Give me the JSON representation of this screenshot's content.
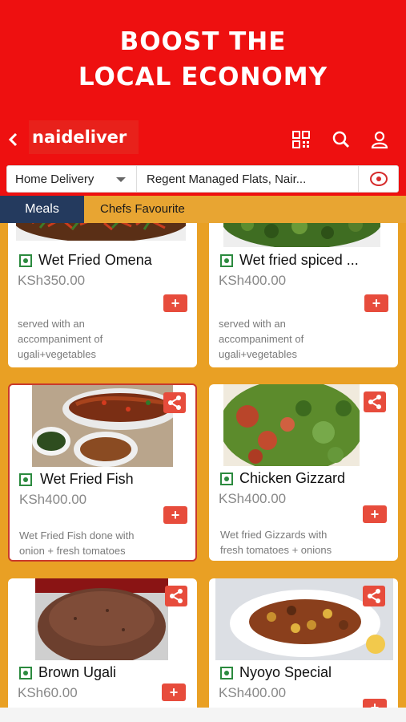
{
  "banner": {
    "line1": "BOOST THE",
    "line2": "LOCAL ECONOMY"
  },
  "header": {
    "back_icon": "chevron-left-icon",
    "logo_text": "naideliver",
    "icons": [
      "qr-code-icon",
      "search-icon",
      "user-icon"
    ]
  },
  "filters": {
    "delivery_mode": "Home Delivery",
    "address": "Regent Managed Flats, Nair...",
    "location_icon": "target-location-icon"
  },
  "tabs": [
    {
      "label": "Meals",
      "active": true
    },
    {
      "label": "Chefs Favourite",
      "active": false
    }
  ],
  "colors": {
    "brand_red": "#ee1010",
    "accent_orange": "#e9a024",
    "tab_navy": "#243a5e",
    "veg_green": "#2b8a3e",
    "button_red": "#e74c3c"
  },
  "meals": [
    {
      "name": "Wet Fried Omena",
      "price": "KSh350.00",
      "desc": [
        "served with an",
        "accompaniment of",
        "ugali+vegetables"
      ]
    },
    {
      "name": "Wet fried spiced ...",
      "price": "KSh400.00",
      "desc": [
        "served with an",
        "accompaniment of",
        "ugali+vegetables"
      ]
    },
    {
      "name": "Wet Fried Fish",
      "price": "KSh400.00",
      "desc": [
        "Wet Fried Fish done with",
        "onion + fresh tomatoes"
      ]
    },
    {
      "name": "Chicken Gizzard",
      "price": "KSh400.00",
      "desc": [
        "Wet fried Gizzards with",
        "fresh tomatoes + onions"
      ]
    },
    {
      "name": "Brown Ugali",
      "price": "KSh60.00",
      "desc": []
    },
    {
      "name": "Nyoyo Special",
      "price": "KSh400.00",
      "desc": []
    }
  ],
  "add_label": "+"
}
